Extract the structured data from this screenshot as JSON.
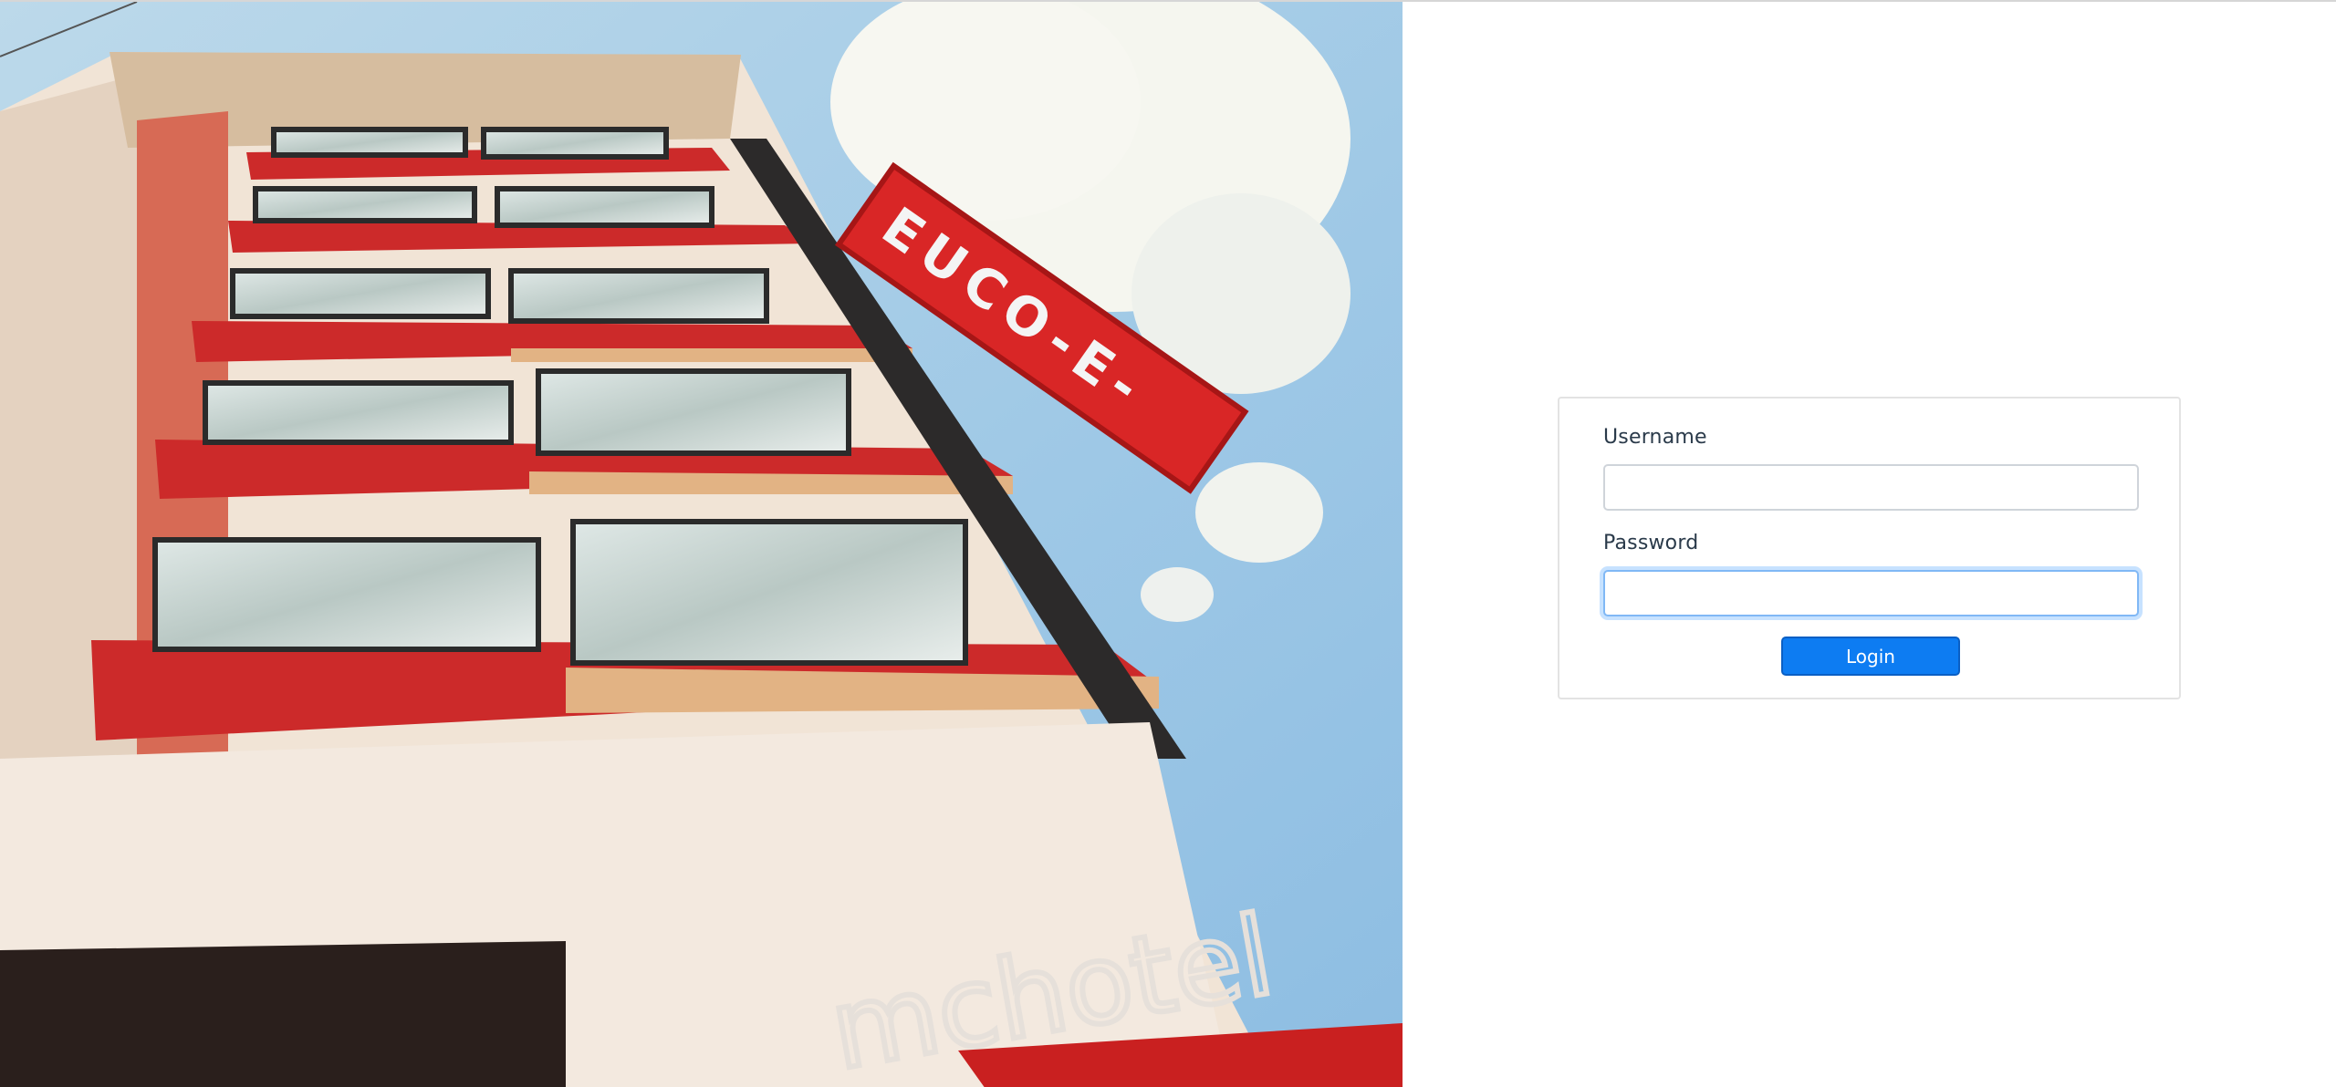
{
  "login": {
    "username_label": "Username",
    "username_value": "",
    "password_label": "Password",
    "password_value": "",
    "submit_label": "Login"
  },
  "hero": {
    "alt": "Hotel building",
    "sign_text": "EUCO-E-",
    "building_text": "mchotel"
  },
  "colors": {
    "accent": "#0d7cf2",
    "focus_ring": "#80b8f5",
    "label_text": "#2a3a4a",
    "card_border": "#e3e3e3"
  }
}
